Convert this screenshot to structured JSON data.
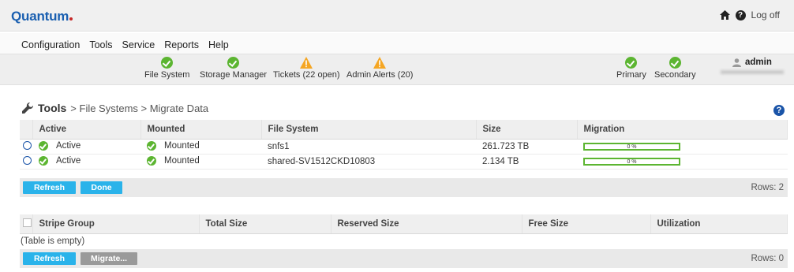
{
  "header": {
    "brand": "Quantum",
    "logoff": "Log off"
  },
  "menu": [
    "Configuration",
    "Tools",
    "Service",
    "Reports",
    "Help"
  ],
  "status": {
    "file_system": "File System",
    "storage_manager": "Storage Manager",
    "tickets": "Tickets (22 open)",
    "admin_alerts": "Admin Alerts (20)",
    "primary": "Primary",
    "secondary": "Secondary",
    "user": "admin"
  },
  "breadcrumb": {
    "section": "Tools",
    "path": "> File Systems > Migrate Data"
  },
  "fs_table": {
    "headers": [
      "Active",
      "Mounted",
      "File System",
      "Size",
      "Migration"
    ],
    "rows": [
      {
        "active": "Active",
        "mounted": "Mounted",
        "fs": "snfs1",
        "size": "261.723 TB",
        "migration": "0 %"
      },
      {
        "active": "Active",
        "mounted": "Mounted",
        "fs": "shared-SV1512CKD10803",
        "size": "2.134 TB",
        "migration": "0 %"
      }
    ],
    "refresh": "Refresh",
    "done": "Done",
    "rows_label": "Rows: 2"
  },
  "sg_table": {
    "headers": [
      "Stripe Group",
      "Total Size",
      "Reserved Size",
      "Free Size",
      "Utilization"
    ],
    "empty": "(Table is empty)",
    "refresh": "Refresh",
    "migrate": "Migrate...",
    "rows_label": "Rows: 0"
  },
  "colors": {
    "brand": "#1a5fb0",
    "ok": "#5cb531",
    "warn": "#f5a623",
    "button": "#2ab3ea"
  }
}
